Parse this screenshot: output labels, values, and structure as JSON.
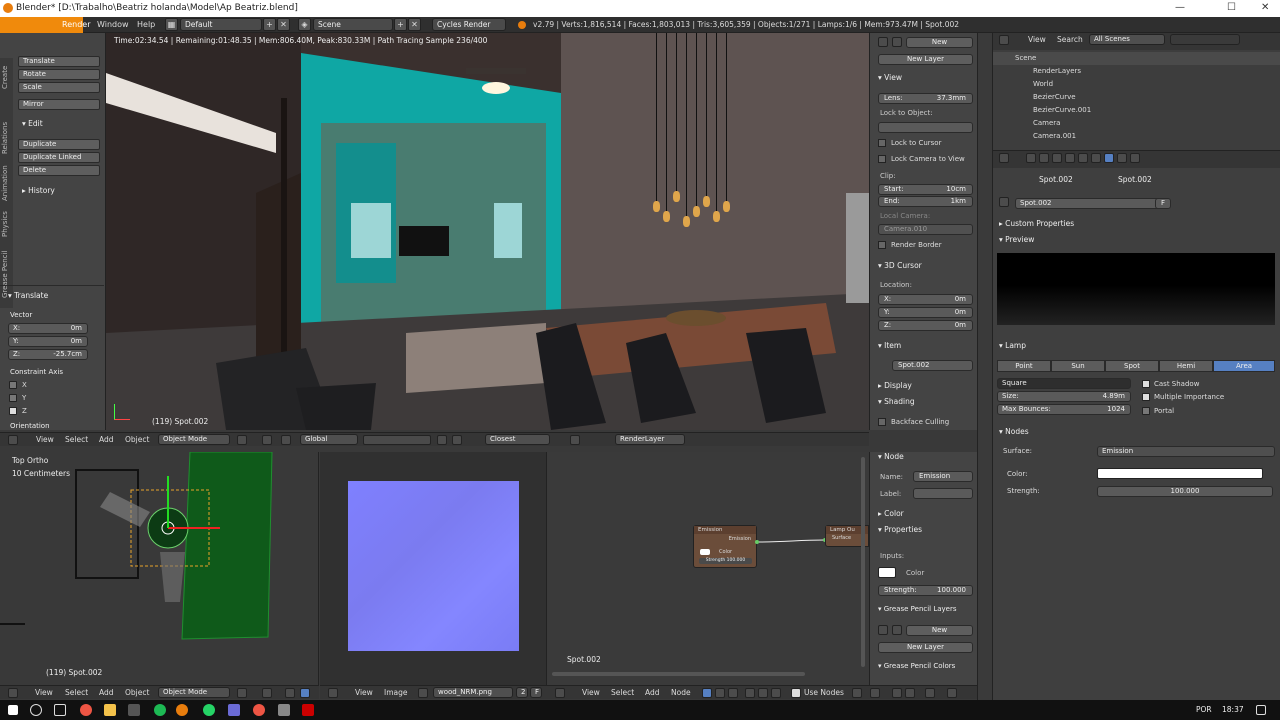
{
  "window": {
    "title": "Blender* [D:\\Trabalho\\Beatriz holanda\\Model\\Ap Beatriz.blend]",
    "minimize": "—",
    "maximize": "☐",
    "close": "✕"
  },
  "topbar": {
    "menus": [
      "Render",
      "Window",
      "Help"
    ],
    "layout": "Default",
    "scene": "Scene",
    "engine": "Cycles Render",
    "stats": "v2.79 | Verts:1,816,514 | Faces:1,803,013 | Tris:3,605,359 | Objects:1/271 | Lamps:1/6 | Mem:973.47M | Spot.002"
  },
  "toolshelf": {
    "tabs": [
      "Create",
      "Relations",
      "Animation",
      "Physics",
      "Grease Pencil"
    ],
    "transform_buttons": [
      "Translate",
      "Rotate",
      "Scale",
      "Mirror"
    ],
    "edit_header": "Edit",
    "edit_buttons": [
      "Duplicate",
      "Duplicate Linked",
      "Delete"
    ],
    "history": "History",
    "op_header": "Translate",
    "vector_label": "Vector",
    "vector": [
      {
        "axis": "X:",
        "value": "0m"
      },
      {
        "axis": "Y:",
        "value": "0m"
      },
      {
        "axis": "Z:",
        "value": "-25.7cm"
      }
    ],
    "constraint_label": "Constraint Axis",
    "constraints": [
      "X",
      "Y",
      "Z"
    ],
    "orientation": "Orientation"
  },
  "viewport": {
    "info": "Time:02:34.54 | Remaining:01:48.35 | Mem:806.40M, Peak:830.33M | Path Tracing Sample 236/400",
    "object_label": "(119) Spot.002",
    "header": {
      "menus": [
        "View",
        "Select",
        "Add",
        "Object"
      ],
      "mode": "Object Mode",
      "orientation": "Global",
      "snap": "Closest",
      "render_layer": "RenderLayer"
    }
  },
  "npanel": {
    "new_btn": "New",
    "new_layer": "New Layer",
    "view_header": "View",
    "lens_label": "Lens:",
    "lens": "37.3mm",
    "lock_object": "Lock to Object:",
    "lock_cursor": "Lock to Cursor",
    "lock_camera": "Lock Camera to View",
    "clip": "Clip:",
    "clip_start_label": "Start:",
    "clip_start": "10cm",
    "clip_end_label": "End:",
    "clip_end": "1km",
    "local_camera": "Local Camera:",
    "camera_field": "Camera.010",
    "render_border": "Render Border",
    "cursor_header": "3D Cursor",
    "location": "Location:",
    "cursor": [
      {
        "axis": "X:",
        "value": "0m"
      },
      {
        "axis": "Y:",
        "value": "0m"
      },
      {
        "axis": "Z:",
        "value": "0m"
      }
    ],
    "item_header": "Item",
    "item_name": "Spot.002",
    "display": "Display",
    "shading": "Shading",
    "backface": "Backface Culling"
  },
  "outliner": {
    "menus": [
      "View",
      "Search"
    ],
    "filter": "All Scenes",
    "rows": [
      "Scene",
      "RenderLayers",
      "World",
      "BezierCurve",
      "BezierCurve.001",
      "Camera",
      "Camera.001"
    ]
  },
  "properties": {
    "breadcrumb": [
      "Spot.002",
      "Spot.002"
    ],
    "name_field": "Spot.002",
    "f_label": "F",
    "custom_props": "Custom Properties",
    "preview": "Preview",
    "lamp": "Lamp",
    "lamp_types": [
      "Point",
      "Sun",
      "Spot",
      "Hemi",
      "Area"
    ],
    "active_type": "Area",
    "shape": "Square",
    "size_label": "Size:",
    "size": "4.89m",
    "bounces_label": "Max Bounces:",
    "bounces": "1024",
    "cast_shadow": "Cast Shadow",
    "multiple_importance": "Multiple Importance",
    "portal": "Portal",
    "nodes": "Nodes",
    "surface_label": "Surface:",
    "surface": "Emission",
    "color_label": "Color:",
    "strength_label": "Strength:",
    "strength": "100.000"
  },
  "bottom_left": {
    "view": "Top Ortho",
    "scale": "10 Centimeters",
    "object": "(119) Spot.002",
    "menus": [
      "View",
      "Select",
      "Add",
      "Object"
    ],
    "mode": "Object Mode"
  },
  "bottom_mid": {
    "menus": [
      "View",
      "Image"
    ],
    "image": "wood_NRM.png",
    "num": "2",
    "f": "F"
  },
  "bottom_right": {
    "object": "Spot.002",
    "menus": [
      "View",
      "Select",
      "Add",
      "Node"
    ],
    "use_nodes": "Use Nodes",
    "node_emission": {
      "title": "Emission",
      "out": "Emission",
      "color": "Color",
      "strength": "Strength 100.000"
    },
    "node_output": {
      "title": "Lamp Ou",
      "surface": "Surface"
    }
  },
  "node_panel": {
    "header": "Node",
    "name_label": "Name:",
    "name": "Emission",
    "label_label": "Label:",
    "color_header": "Color",
    "properties": "Properties",
    "inputs": "Inputs:",
    "color": "Color",
    "strength_label": "Strength:",
    "strength": "100.000",
    "gp_layers": "Grease Pencil Layers",
    "new": "New",
    "new_layer": "New Layer",
    "gp_colors": "Grease Pencil Colors"
  },
  "taskbar": {
    "lang": "POR",
    "time": "18:37"
  },
  "colors": {
    "accent": "#5680c2",
    "teal_wall": "#0fa7a4",
    "node_header": "#6b4d3a"
  }
}
